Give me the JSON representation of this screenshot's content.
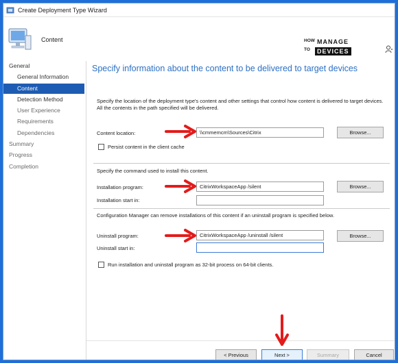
{
  "window": {
    "title": "Create Deployment Type Wizard"
  },
  "header": {
    "section": "Content"
  },
  "logo": {
    "how": "HOW",
    "to": "TO",
    "manage": "MANAGE",
    "devices": "DEVICES"
  },
  "sidebar": {
    "items": [
      {
        "label": "General",
        "level": "top",
        "state": "normal"
      },
      {
        "label": "General Information",
        "level": "sub",
        "state": "normal"
      },
      {
        "label": "Content",
        "level": "sub",
        "state": "active"
      },
      {
        "label": "Detection Method",
        "level": "sub",
        "state": "normal"
      },
      {
        "label": "User Experience",
        "level": "sub",
        "state": "dim"
      },
      {
        "label": "Requirements",
        "level": "sub",
        "state": "dim"
      },
      {
        "label": "Dependencies",
        "level": "sub",
        "state": "dim"
      },
      {
        "label": "Summary",
        "level": "top",
        "state": "dim"
      },
      {
        "label": "Progress",
        "level": "top",
        "state": "dim"
      },
      {
        "label": "Completion",
        "level": "top",
        "state": "dim"
      }
    ]
  },
  "main": {
    "title": "Specify information about the content to be delivered to target devices",
    "description": "Specify the location of the deployment type's content and other settings that control how content is delivered to target devices. All the contents in the path specified will be delivered.",
    "content_location_label": "Content location:",
    "content_location_value": "\\\\cmmemcm\\Sources\\Citrix",
    "persist_label": "Persist content in the client cache",
    "install_section_text": "Specify the command used to install this content.",
    "install_program_label": "Installation program:",
    "install_program_value": "CitrixWorkspaceApp /silent",
    "install_start_label": "Installation start in:",
    "install_start_value": "",
    "uninstall_section_text": "Configuration Manager can remove installations of this content if an uninstall program is specified below.",
    "uninstall_program_label": "Uninstall program:",
    "uninstall_program_value": "CitrixWorkspaceApp /uninstall /silent",
    "uninstall_start_label": "Uninstall start in:",
    "uninstall_start_value": "",
    "run32_label": "Run installation and uninstall program as 32-bit process on 64-bit clients.",
    "browse_label": "Browse..."
  },
  "footer": {
    "previous": "< Previous",
    "next": "Next >",
    "summary": "Summary",
    "cancel": "Cancel"
  },
  "colors": {
    "frame": "#1e6fd9",
    "active_nav": "#1e5cb3",
    "title_blue": "#2c70c4",
    "annotation_red": "#e31b1b"
  }
}
